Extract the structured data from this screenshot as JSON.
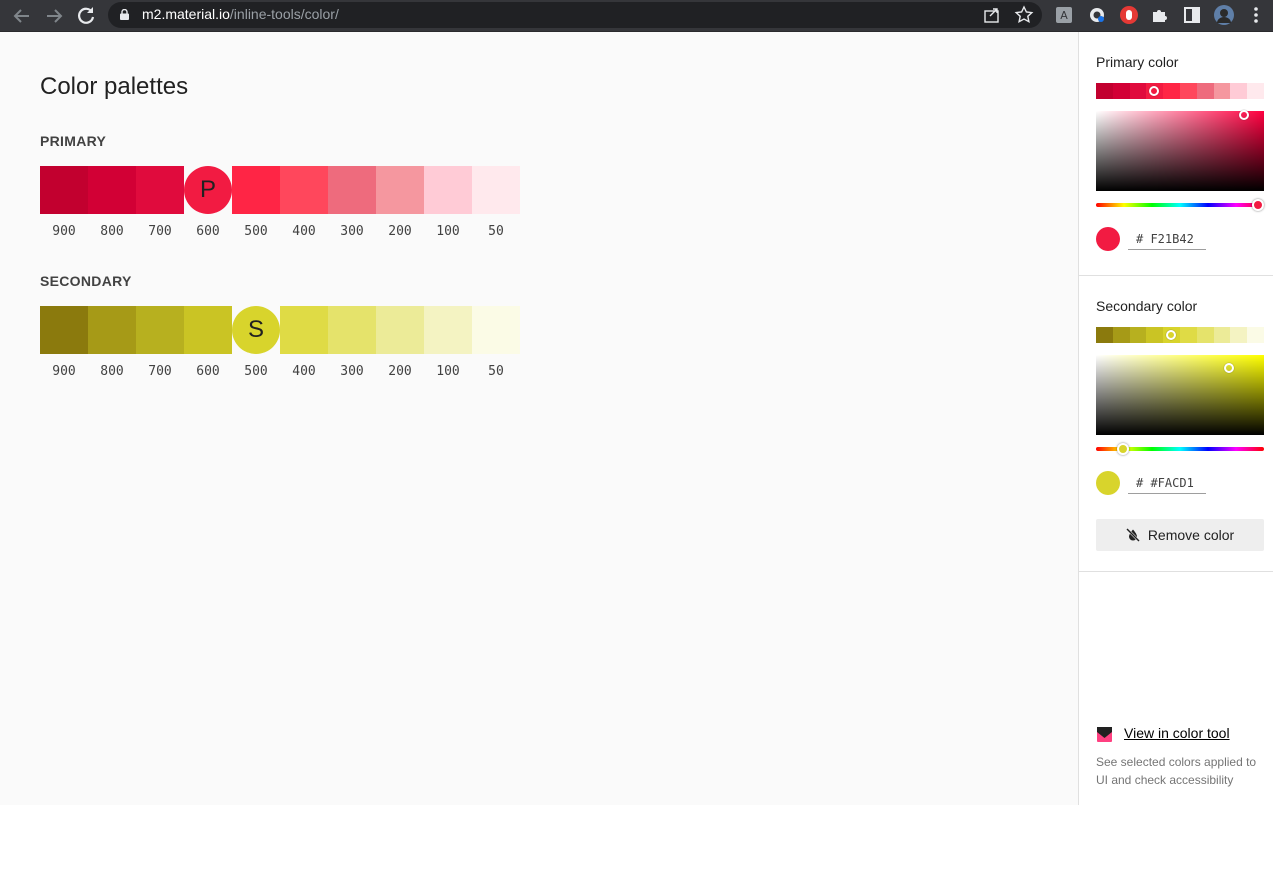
{
  "browser": {
    "url_host": "m2.material.io",
    "url_path": "/inline-tools/color/"
  },
  "page": {
    "title": "Color palettes"
  },
  "primary": {
    "label": "PRIMARY",
    "selected_letter": "P",
    "swatches": [
      "#c2002f",
      "#d20035",
      "#e00b3d",
      "#f21b42",
      "#ff2545",
      "#ff475c",
      "#ee6b7d",
      "#f5979f",
      "#ffcbd6",
      "#ffe9ed"
    ],
    "shades": [
      "900",
      "800",
      "700",
      "600",
      "500",
      "400",
      "300",
      "200",
      "100",
      "50"
    ],
    "selected_index": 3
  },
  "secondary": {
    "label": "SECONDARY",
    "selected_letter": "S",
    "swatches": [
      "#8b7a0d",
      "#a69a17",
      "#b7b01f",
      "#cac424",
      "#d8d42c",
      "#dfdb45",
      "#e5e36b",
      "#eceb98",
      "#f4f3c2",
      "#fbfbe6"
    ],
    "shades": [
      "900",
      "800",
      "700",
      "600",
      "500",
      "400",
      "300",
      "200",
      "100",
      "50"
    ],
    "selected_index": 4
  },
  "panel": {
    "primary_title": "Primary color",
    "primary_hex": "# F21B42",
    "primary_color": "#f21b42",
    "primary_hue_color": "#ff0040",
    "secondary_title": "Secondary color",
    "secondary_hex": "# #FACD1",
    "secondary_color": "#d8d42c",
    "secondary_hue_color": "#ffff00",
    "remove_label": "Remove color",
    "tool_link": "View in color tool",
    "tool_desc": "See selected colors applied to UI and check accessibility"
  }
}
